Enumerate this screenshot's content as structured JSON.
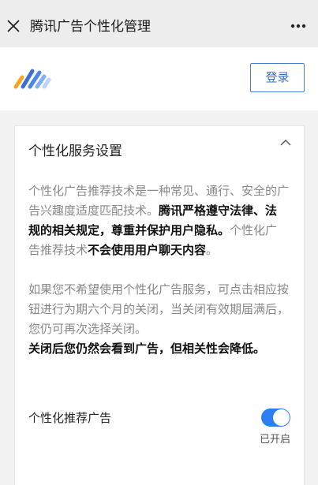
{
  "titlebar": {
    "title": "腾讯广告个性化管理"
  },
  "header": {
    "login_label": "登录"
  },
  "card": {
    "title": "个性化服务设置",
    "paragraph1": {
      "seg1": "个性化广告推荐技术是一种常见、通行、安全的广告兴趣度适度匹配技术。",
      "seg2": "腾讯严格遵守法律、法规的相关规定，尊重并保护用户隐私。",
      "seg3": "个性化广告推荐技术",
      "seg4": "不会使用用户聊天内容",
      "seg5": "。"
    },
    "paragraph2": {
      "seg1": "如果您不希望使用个性化广告服务，可点击相应按钮进行为期六个月的关闭，当关闭有效期届满后，您仍可再次选择关闭。",
      "seg2": "关闭后您仍然会看到广告，但相关性会降低。"
    },
    "toggle": {
      "label": "个性化推荐广告",
      "status": "已开启",
      "on": true
    }
  },
  "colors": {
    "accent": "#2b7ef6",
    "login_border": "#4a7bd6",
    "titlebar_bg": "#ededed",
    "page_bg": "#f2f2f2"
  },
  "icons": {
    "close": "close-icon",
    "more": "more-icon",
    "collapse": "chevron-up-icon",
    "logo": "tencent-ads-logo"
  }
}
